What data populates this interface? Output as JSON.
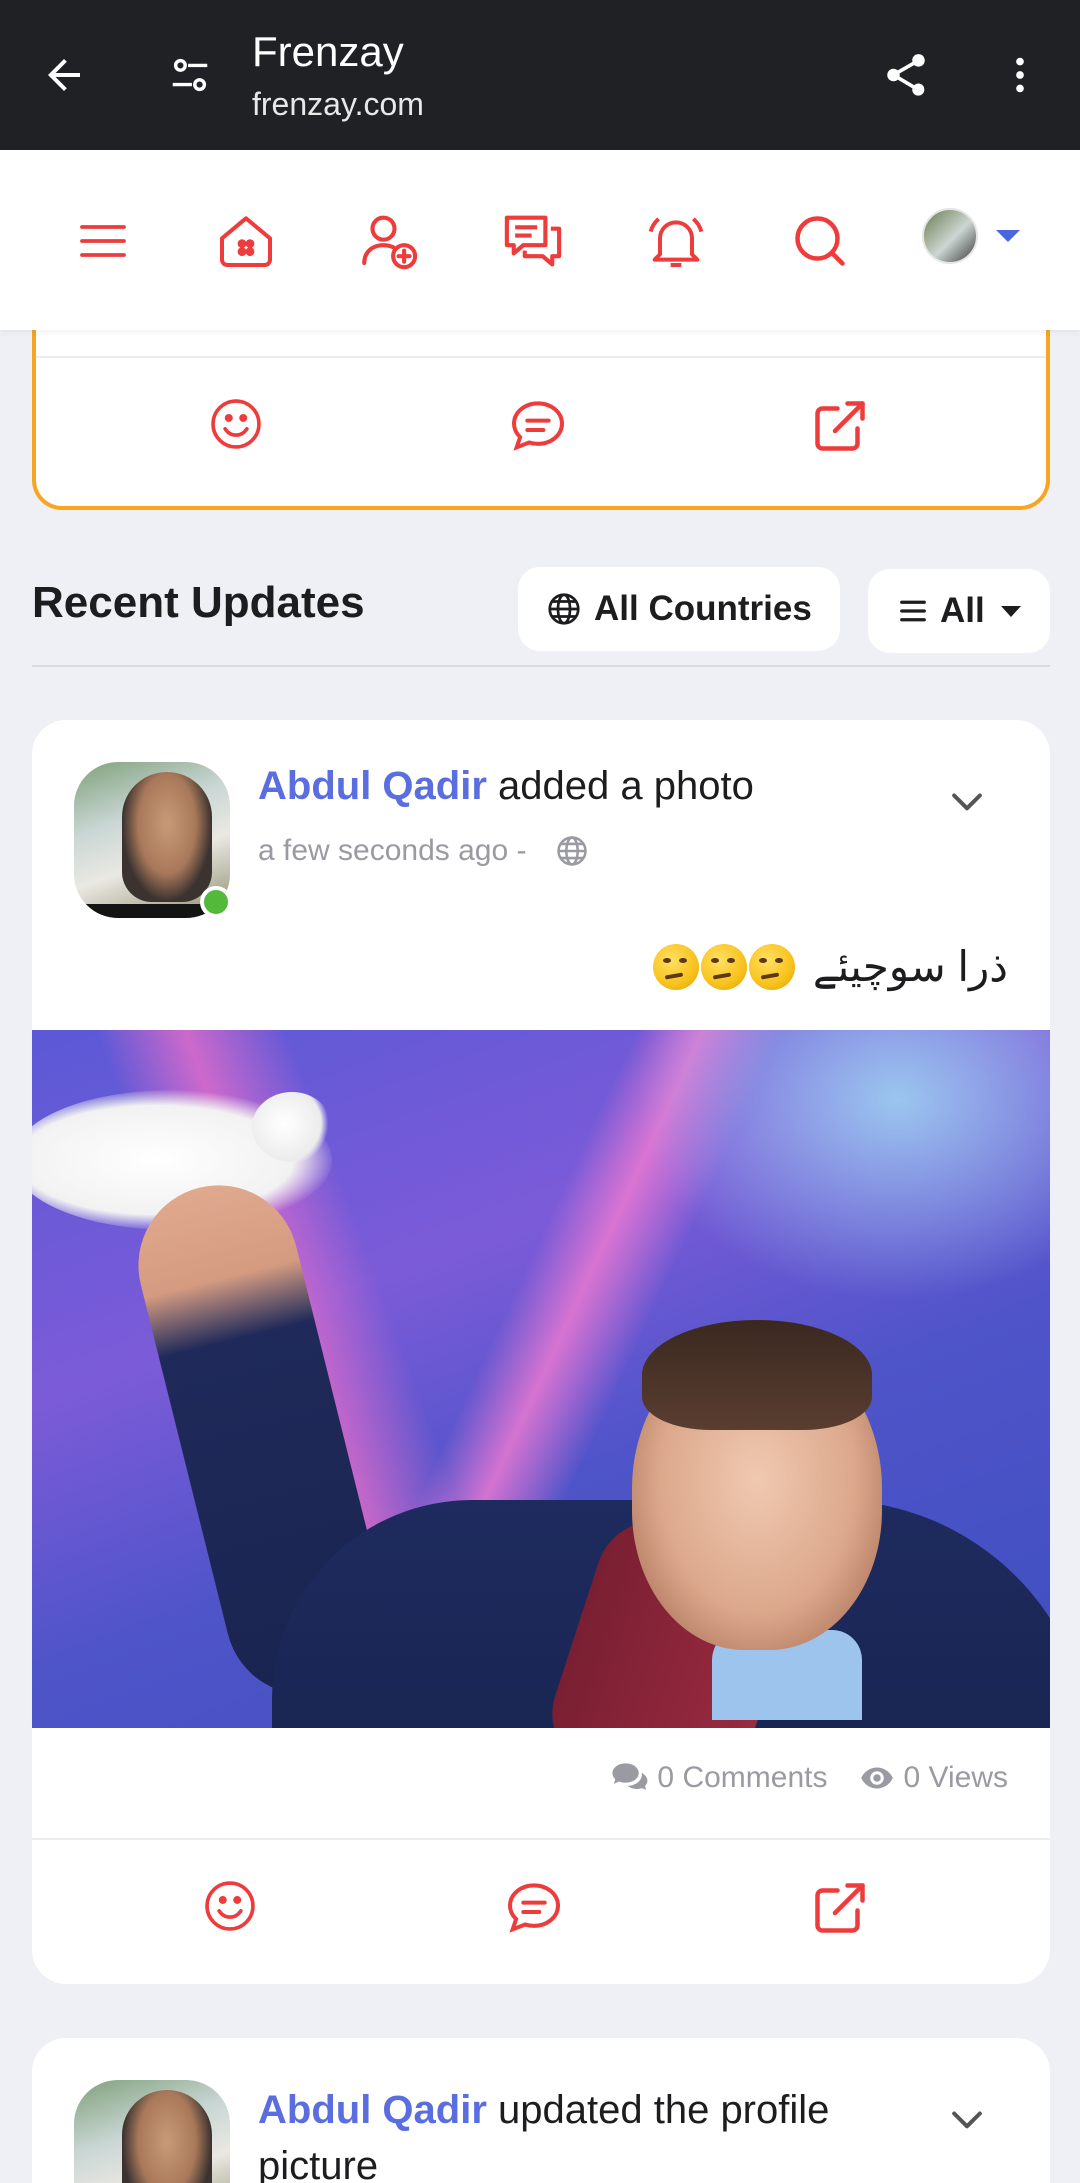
{
  "browser": {
    "site_title": "Frenzay",
    "url": "frenzay.com"
  },
  "nav": {
    "items": [
      "menu-icon",
      "home-icon",
      "add-friend-icon",
      "messages-icon",
      "notifications-icon",
      "search-icon",
      "profile-avatar"
    ]
  },
  "feed": {
    "section_title": "Recent Updates",
    "country_filter": "All Countries",
    "type_filter": "All"
  },
  "posts": [
    {
      "author": "Abdul Qadir",
      "action": "added a photo",
      "time": "a few seconds ago -",
      "text": "ذرا سوچیئے",
      "comments": "0 Comments",
      "views": "0 Views"
    },
    {
      "author": "Abdul Qadir",
      "action": "updated the profile picture"
    }
  ],
  "colors": {
    "brand_red": "#ee3b3b",
    "author_blue": "#5a6ee0",
    "highlight_border": "#f5a623",
    "online": "#52b93b"
  }
}
